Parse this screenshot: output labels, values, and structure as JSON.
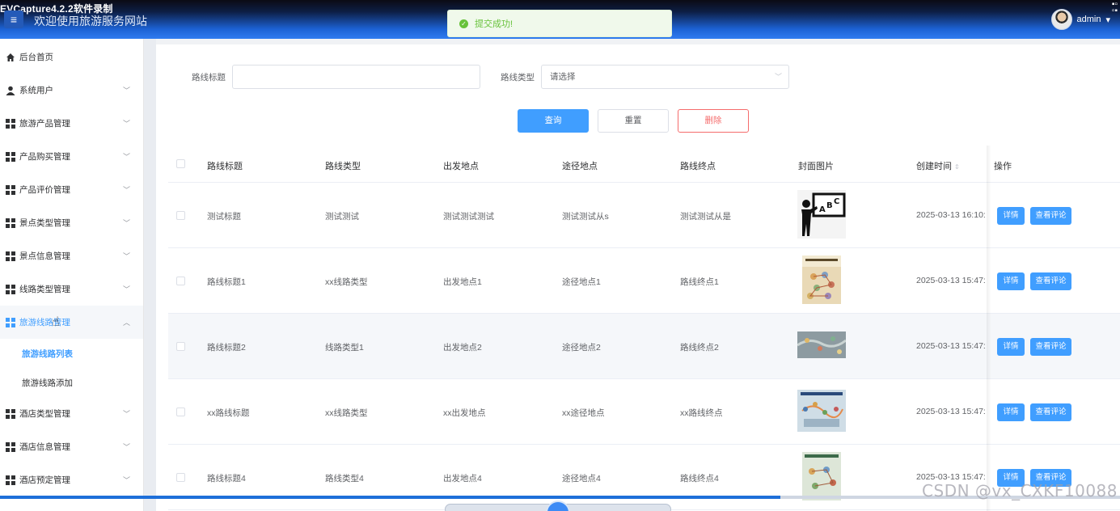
{
  "recorder_title": "EVCapture4.2.2软件录制",
  "header": {
    "site_title": "欢迎使用旅游服务网站",
    "user": "admin"
  },
  "toast": {
    "message": "提交成功!"
  },
  "sidebar": {
    "items": [
      {
        "label": "后台首页",
        "icon": "home-icon"
      },
      {
        "label": "系统用户",
        "icon": "user-icon"
      },
      {
        "label": "旅游产品管理",
        "icon": "grid-icon"
      },
      {
        "label": "产品购买管理",
        "icon": "grid-icon"
      },
      {
        "label": "产品评价管理",
        "icon": "grid-icon"
      },
      {
        "label": "景点类型管理",
        "icon": "grid-icon"
      },
      {
        "label": "景点信息管理",
        "icon": "grid-icon"
      },
      {
        "label": "线路类型管理",
        "icon": "grid-icon"
      },
      {
        "label": "旅游线路管理",
        "icon": "grid-icon"
      },
      {
        "label": "酒店类型管理",
        "icon": "grid-icon"
      },
      {
        "label": "酒店信息管理",
        "icon": "grid-icon"
      },
      {
        "label": "酒店预定管理",
        "icon": "grid-icon"
      }
    ],
    "submenu": [
      {
        "label": "旅游线路列表"
      },
      {
        "label": "旅游线路添加"
      }
    ]
  },
  "search": {
    "title_label": "路线标题",
    "title_value": "",
    "type_label": "路线类型",
    "type_placeholder": "请选择",
    "query_btn": "查询",
    "reset_btn": "重置",
    "delete_btn": "删除"
  },
  "table": {
    "columns": [
      "路线标题",
      "路线类型",
      "出发地点",
      "途径地点",
      "路线终点",
      "封面图片",
      "创建时间",
      "操作"
    ],
    "rows": [
      {
        "title": "测试标题",
        "type": "测试测试",
        "start": "测试测试测试",
        "via": "测试测试从s",
        "end": "测试测试从是",
        "time": "2025-03-13 16:10:"
      },
      {
        "title": "路线标题1",
        "type": "xx线路类型",
        "start": "出发地点1",
        "via": "途径地点1",
        "end": "路线终点1",
        "time": "2025-03-13 15:47:"
      },
      {
        "title": "路线标题2",
        "type": "线路类型1",
        "start": "出发地点2",
        "via": "途径地点2",
        "end": "路线终点2",
        "time": "2025-03-13 15:47:"
      },
      {
        "title": "xx路线标题",
        "type": "xx线路类型",
        "start": "xx出发地点",
        "via": "xx途径地点",
        "end": "xx路线终点",
        "time": "2025-03-13 15:47:"
      },
      {
        "title": "路线标题4",
        "type": "路线类型4",
        "start": "出发地点4",
        "via": "途径地点4",
        "end": "路线终点4",
        "time": "2025-03-13 15:47:"
      }
    ],
    "detail_btn": "详情",
    "comment_btn": "查看评论"
  },
  "watermark": "CSDN @vx_CXKF10088",
  "colors": {
    "primary": "#409eff",
    "danger": "#f56c6c",
    "success": "#67c23a",
    "header": "#2f7cf0"
  }
}
